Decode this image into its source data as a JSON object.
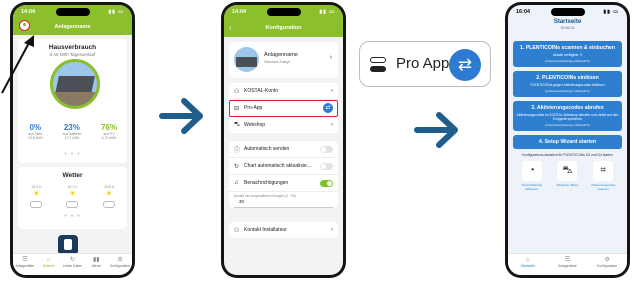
{
  "phone1": {
    "time": "14:04",
    "title": "Anlagenname",
    "card1": {
      "title": "Hausverbrauch",
      "subtitle": "8,40 kWh Tagesverlauf",
      "stats": [
        {
          "value": "0%",
          "label": "aus Netz\n10,6 kWh",
          "color": "#2e7ad1"
        },
        {
          "value": "23%",
          "label": "aus Batterie\n2,07 kWh",
          "color": "#2e7ad1"
        },
        {
          "value": "76%",
          "label": "aus PV\n6,70 kWh",
          "color": "#8bbf2c"
        }
      ]
    },
    "weather": {
      "title": "Wetter",
      "days": [
        "10,3 h",
        "10,7 h",
        "10,8 h"
      ]
    },
    "tabs": [
      "Anlagenfilter",
      "Batterie",
      "Letzte Daten",
      "Werte",
      "Konfiguration"
    ]
  },
  "phone2": {
    "time": "14:04",
    "title": "Konfiguration",
    "plant": {
      "name": "Anlagenname",
      "sub": "Standard-Anlage"
    },
    "rows1": [
      {
        "icon": "Ⓚ",
        "label": "KOSTAL-Konto"
      },
      {
        "icon": "⊟",
        "label": "Pro-App",
        "highlight": true
      },
      {
        "icon": "⛍",
        "label": "Webshop"
      }
    ],
    "rows2": [
      {
        "icon": "ⓘ",
        "label": "Automatisch senden"
      },
      {
        "icon": "↻",
        "label": "Chart automatisch aktualisie..."
      },
      {
        "icon": "🔔",
        "label": "Benachrichtigungen"
      }
    ],
    "hint": "Anzahl der vorgehaltenen Anlagen (1 - 99)",
    "count": "30",
    "contact": "Kontakt Installateur"
  },
  "callout": {
    "label": "Pro App"
  },
  "phone3": {
    "time": "16:04",
    "title": "Startseite",
    "date": "30.06.24",
    "steps": [
      {
        "title": "1. PLENTICOINs scannen & einbuchen",
        "desc": "Aktuell verfügbar: 0",
        "note": "(Internetverbindung erforderlich)"
      },
      {
        "title": "2. PLENTICOINs einlösen",
        "desc": "PLENTICOINs gegen Aktivierungscodes einlösen",
        "note": "(Internetverbindung erforderlich)"
      },
      {
        "title": "3. Aktivierungscodes abrufen",
        "desc": "Aktivierungscodes im KOSTAL Webshop abrufen und direkt auf den Endgerät speichern",
        "note": "(Internetverbindung erforderlich)"
      },
      {
        "title": "4. Setup Wizard starten",
        "desc": "",
        "note": ""
      }
    ],
    "wizard_text": "Konfigurations-Assistent für PLENTICOINs G3 und G4 starten",
    "icon_labels": [
      "Smart Metering aktivieren",
      "Webshop öffnen",
      "Aktivierungscodes scannen"
    ],
    "tabs": [
      "Startseite",
      "Anlagenliste",
      "Konfiguration"
    ]
  }
}
